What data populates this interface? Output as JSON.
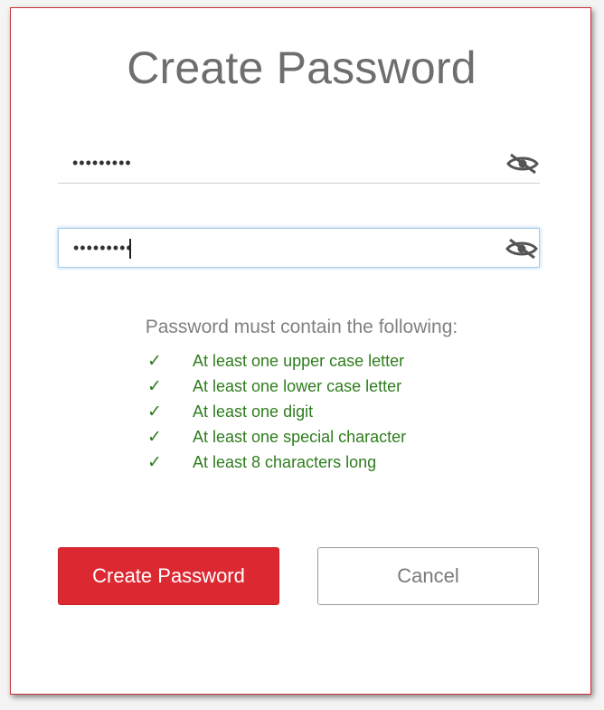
{
  "form": {
    "title": "Create Password",
    "password_field": {
      "value": "•••••••••",
      "toggle_icon": "eye-slash-icon"
    },
    "confirm_field": {
      "value": "•••••••••",
      "toggle_icon": "eye-slash-icon"
    },
    "requirements": {
      "heading": "Password must contain the following:",
      "check_glyph": "✓",
      "items": [
        "At least one upper case letter",
        "At least one lower case letter",
        "At least one digit",
        "At least one special character",
        "At least 8 characters long"
      ]
    },
    "buttons": {
      "create_label": "Create Password",
      "cancel_label": "Cancel"
    }
  },
  "colors": {
    "accent": "#dc2831",
    "border": "#c8323a",
    "success": "#2e7d1d",
    "title": "#6e6e6e",
    "focus": "#a9cde8"
  }
}
